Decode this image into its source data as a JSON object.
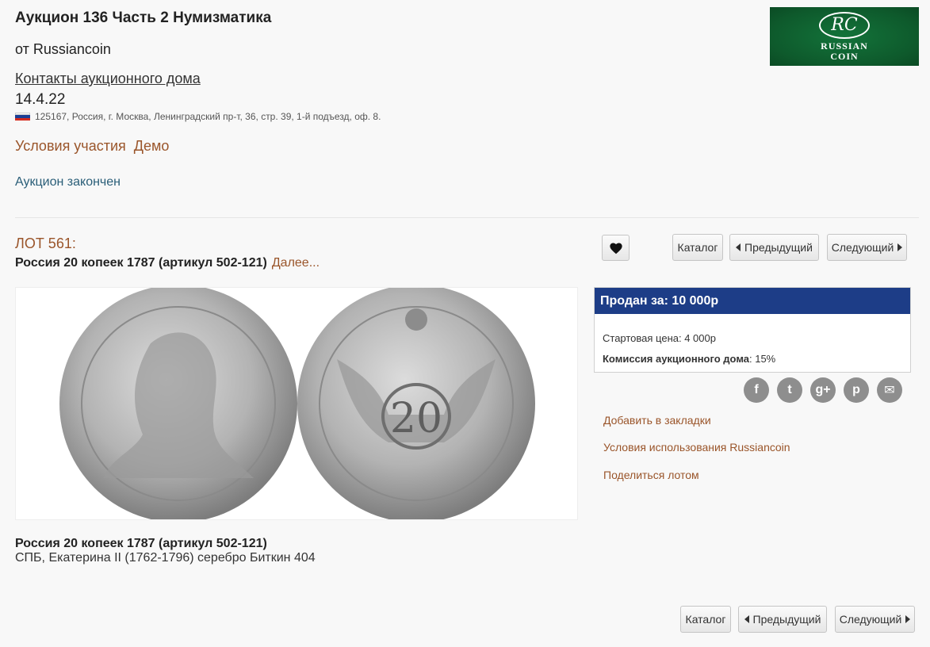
{
  "header": {
    "title": "Аукцион 136 Часть 2 Нумизматика",
    "from": "от Russiancoin",
    "contacts_link": "Контакты аукционного дома",
    "date": "14.4.22",
    "address": "125167, Россия, г. Москва, Ленинградский пр-т, 36, стр. 39, 1-й подъезд, оф. 8.",
    "terms_link": "Условия участия",
    "demo_link": "Демо",
    "status": "Аукцион закончен"
  },
  "logo": {
    "monogram": "RC",
    "line1": "RUSSIAN",
    "line2": "COIN",
    "bg_color": "#0e5a2c"
  },
  "lot": {
    "number": "ЛОТ 561:",
    "title": "Россия 20 копеек 1787 (артикул 502-121)",
    "more_link": "Далее..."
  },
  "nav": {
    "catalog": "Каталог",
    "prev": "Предыдущий",
    "next": "Следующий"
  },
  "sale": {
    "sold_label": "Продан за: 10 000р",
    "start_price": "Стартовая цена:  4 000р",
    "commission_label": "Комиссия аукционного дома",
    "commission_value": ": 15%",
    "header_color": "#1d3d87"
  },
  "social": {
    "icons": [
      "facebook-icon",
      "twitter-icon",
      "google-plus-icon",
      "pinterest-icon",
      "email-icon"
    ],
    "glyphs": [
      "f",
      "t",
      "g+",
      "p",
      "✉"
    ]
  },
  "side_links": {
    "bookmark": "Добавить в закладки",
    "usage_terms": "Условия использования Russiancoin",
    "share": "Поделиться лотом"
  },
  "description": {
    "title": "Россия 20 копеек 1787 (артикул 502-121)",
    "text": "СПБ, Екатерина II (1762-1796) серебро Биткин 404"
  },
  "colors": {
    "link_brown": "#9a552a",
    "status_blue": "#2a5e78"
  }
}
